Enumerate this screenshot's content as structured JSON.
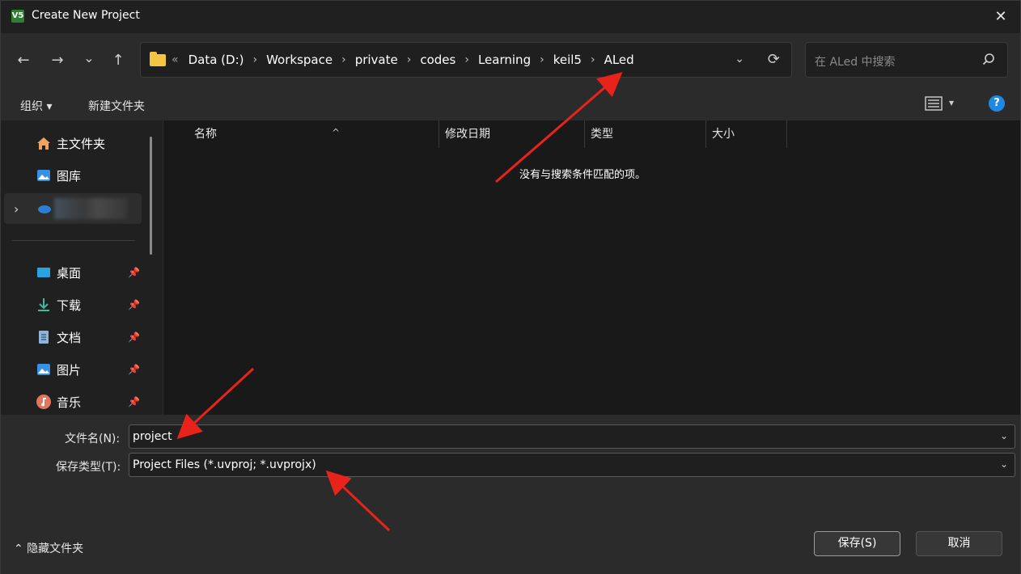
{
  "window": {
    "title": "Create New Project",
    "app_icon_glyph": "V5",
    "close_glyph": "✕"
  },
  "nav": {
    "back_glyph": "←",
    "forward_glyph": "→",
    "recent_glyph": "⌄",
    "up_glyph": "↑",
    "lead_glyph": "«",
    "breadcrumb": [
      "Data (D:)",
      "Workspace",
      "private",
      "codes",
      "Learning",
      "keil5",
      "ALed"
    ],
    "separator": "›",
    "dropdown_glyph": "⌄",
    "refresh_glyph": "⟳",
    "search_placeholder": "在 ALed 中搜索"
  },
  "toolbar": {
    "organize_label": "组织 ▾",
    "new_folder_label": "新建文件夹",
    "view_dropdown_glyph": "▾",
    "help_glyph": "?"
  },
  "sidebar": {
    "items": [
      {
        "label": "主文件夹",
        "icon": "home-icon"
      },
      {
        "label": "图库",
        "icon": "gallery-icon"
      },
      {
        "label": "",
        "icon": "cloud-icon",
        "expand_glyph": "›"
      },
      {
        "label": "桌面",
        "icon": "desktop-icon",
        "pinned": true
      },
      {
        "label": "下载",
        "icon": "download-icon",
        "pinned": true
      },
      {
        "label": "文档",
        "icon": "document-icon",
        "pinned": true
      },
      {
        "label": "图片",
        "icon": "pictures-icon",
        "pinned": true
      },
      {
        "label": "音乐",
        "icon": "music-icon",
        "pinned": true
      }
    ],
    "pin_glyph": "📌"
  },
  "columns": {
    "name": "名称",
    "modified": "修改日期",
    "type": "类型",
    "size": "大小",
    "sort_glyph": "^"
  },
  "file_list": {
    "empty_message": "没有与搜索条件匹配的项。"
  },
  "form": {
    "filename_label": "文件名(N):",
    "filename_value": "project",
    "filetype_label": "保存类型(T):",
    "filetype_value": "Project Files (*.uvproj; *.uvprojx)",
    "dropdown_glyph": "⌄"
  },
  "footer": {
    "hide_folders_label": "⌃ 隐藏文件夹",
    "save_label": "保存(S)",
    "cancel_label": "取消"
  },
  "colors": {
    "annotation_arrow": "#e8231c",
    "folder": "#f4c542",
    "help": "#1e88e5"
  }
}
